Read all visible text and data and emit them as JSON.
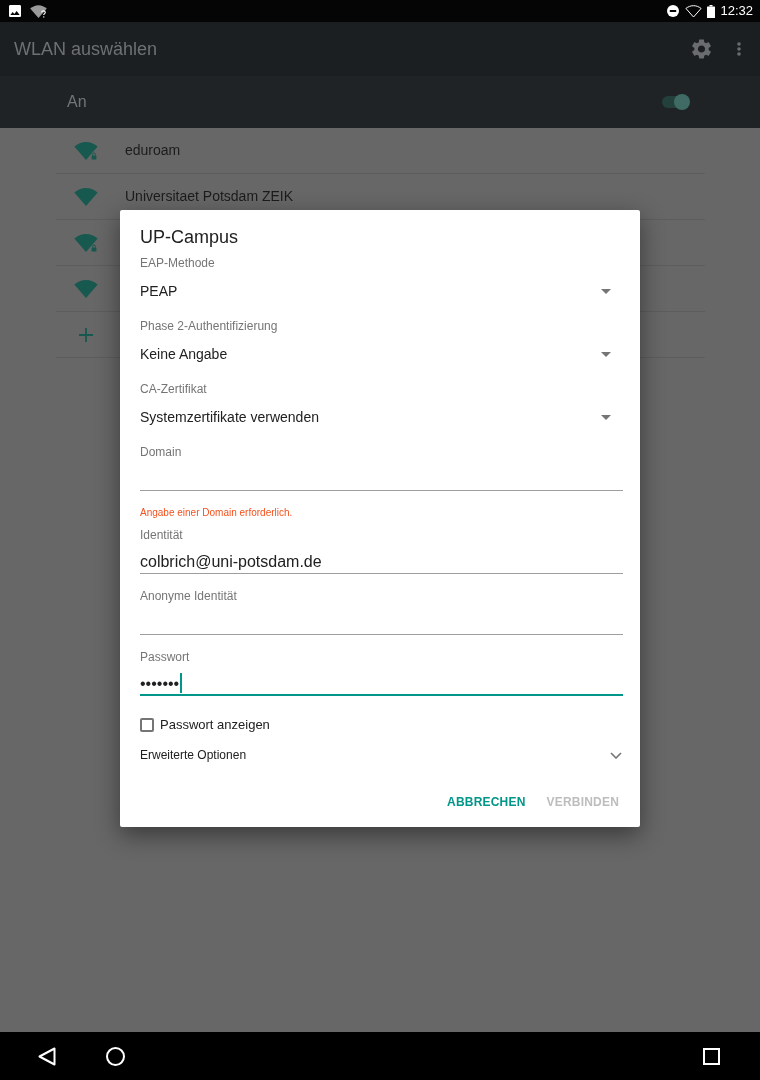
{
  "status_bar": {
    "time": "12:32"
  },
  "app_bar": {
    "title": "WLAN auswählen"
  },
  "wifi_toggle": {
    "label": "An",
    "on": true
  },
  "networks": [
    {
      "name": "eduroam",
      "secured": true
    },
    {
      "name": "Universitaet Potsdam ZEIK",
      "secured": false
    },
    {
      "secured": true
    },
    {
      "secured": false
    }
  ],
  "dialog": {
    "title": "UP-Campus",
    "fields": [
      {
        "kind": "dropdown",
        "label": "EAP-Methode",
        "value": "PEAP"
      },
      {
        "kind": "dropdown",
        "label": "Phase 2-Authentifizierung",
        "value": "Keine Angabe"
      },
      {
        "kind": "dropdown",
        "label": "CA-Zertifikat",
        "value": "Systemzertifikate verwenden"
      },
      {
        "kind": "text",
        "label": "Domain",
        "focused": false,
        "error": "Angabe einer Domain erforderlich."
      },
      {
        "kind": "text",
        "label": "Identität",
        "value": "colbrich@uni-potsdam.de",
        "focused": false
      },
      {
        "kind": "text",
        "label": "Anonyme Identität",
        "focused": false
      },
      {
        "kind": "text",
        "label": "Passwort",
        "value": "•••••••",
        "focused": true
      }
    ],
    "show_password": {
      "label": "Passwort anzeigen",
      "checked": false
    },
    "advanced_options": {
      "label": "Erweiterte Optionen",
      "expanded": false
    },
    "buttons": [
      {
        "label": "ABBRECHEN",
        "disabled": false
      },
      {
        "label": "VERBINDEN",
        "disabled": true
      }
    ]
  }
}
